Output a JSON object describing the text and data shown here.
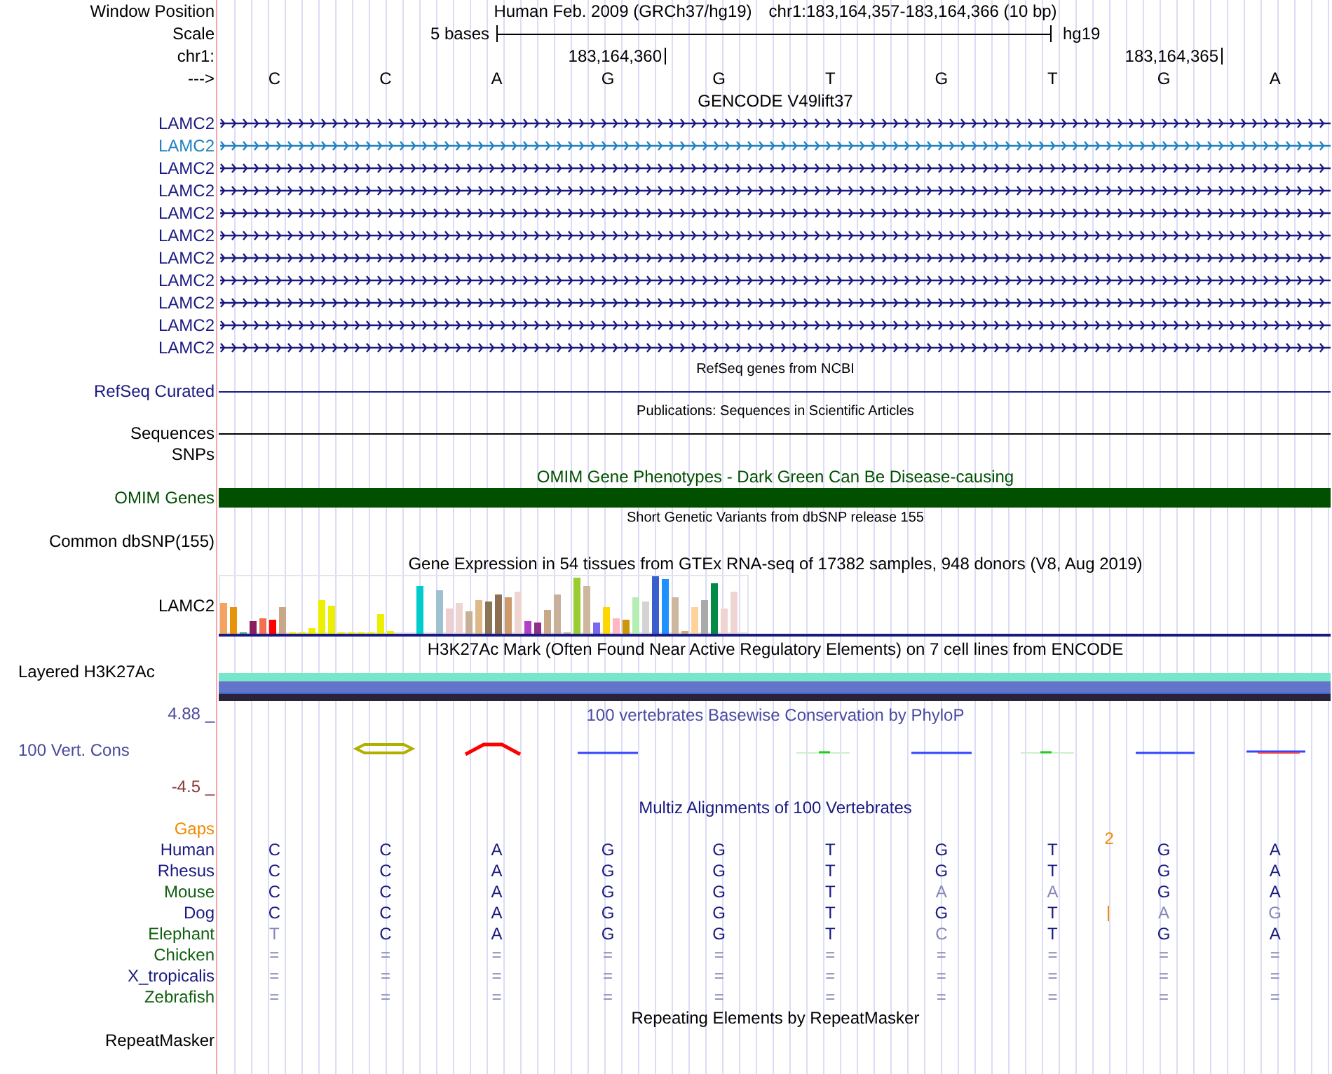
{
  "window_position": {
    "label": "Window Position",
    "assembly": "Human Feb. 2009 (GRCh37/hg19)",
    "range": "chr1:183,164,357-183,164,366 (10 bp)"
  },
  "scale": {
    "label": "Scale",
    "length": "5 bases",
    "assembly": "hg19"
  },
  "coordinates": {
    "label": "chr1:",
    "positions": [
      "183,164,360",
      "183,164,365"
    ]
  },
  "strand": {
    "label": "--->",
    "bases": [
      "C",
      "C",
      "A",
      "G",
      "G",
      "T",
      "G",
      "T",
      "G",
      "A"
    ]
  },
  "tracks": [
    {
      "kind": "genes",
      "title": "GENCODE V49lift37",
      "rows": [
        {
          "label": "LAMC2",
          "color": "#191980"
        },
        {
          "label": "LAMC2",
          "color": "#2080c0"
        },
        {
          "label": "LAMC2",
          "color": "#191980"
        },
        {
          "label": "LAMC2",
          "color": "#191980"
        },
        {
          "label": "LAMC2",
          "color": "#191980"
        },
        {
          "label": "LAMC2",
          "color": "#191980"
        },
        {
          "label": "LAMC2",
          "color": "#191980"
        },
        {
          "label": "LAMC2",
          "color": "#191980"
        },
        {
          "label": "LAMC2",
          "color": "#191980"
        },
        {
          "label": "LAMC2",
          "color": "#191980"
        },
        {
          "label": "LAMC2",
          "color": "#191980"
        }
      ]
    },
    {
      "kind": "line",
      "title": "RefSeq genes from NCBI",
      "label": "RefSeq Curated",
      "color": "#191980"
    },
    {
      "kind": "line",
      "title": "Publications: Sequences in Scientific Articles",
      "label": "Sequences",
      "color": "#000000"
    },
    {
      "kind": "label",
      "label": "SNPs"
    },
    {
      "kind": "bar",
      "title": "OMIM Gene Phenotypes - Dark Green Can Be Disease-causing",
      "label": "OMIM Genes",
      "color": "#005000"
    },
    {
      "kind": "variants",
      "title": "Short Genetic Variants from dbSNP release 155",
      "label": "Common dbSNP(155)"
    },
    {
      "kind": "expression",
      "title": "Gene Expression in 54 tissues from GTEx RNA-seq of 17382 samples, 948 donors (V8, Aug 2019)",
      "label": "LAMC2"
    },
    {
      "kind": "layered",
      "title": "H3K27Ac Mark (Often Found Near Active Regulatory Elements) on 7 cell lines from ENCODE",
      "label": "Layered H3K27Ac"
    },
    {
      "kind": "conservation",
      "title": "100 vertebrates Basewise Conservation by PhyloP",
      "label": "100 Vert. Cons",
      "max": "4.88 _",
      "min": "-4.5 _"
    },
    {
      "kind": "alignment",
      "title": "Multiz Alignments of 100 Vertebrates",
      "gaps": {
        "label": "Gaps",
        "count": "2"
      },
      "species": [
        {
          "label": "Human",
          "color": "#191980",
          "insertion": false,
          "bases": [
            {
              "t": "C",
              "faded": false
            },
            {
              "t": "C",
              "faded": false
            },
            {
              "t": "A",
              "faded": false
            },
            {
              "t": "G",
              "faded": false
            },
            {
              "t": "G",
              "faded": false
            },
            {
              "t": "T",
              "faded": false
            },
            {
              "t": "G",
              "faded": false
            },
            {
              "t": "T",
              "faded": false
            },
            {
              "t": "G",
              "faded": false
            },
            {
              "t": "A",
              "faded": false
            }
          ]
        },
        {
          "label": "Rhesus",
          "color": "#191980",
          "insertion": false,
          "bases": [
            {
              "t": "C",
              "faded": false
            },
            {
              "t": "C",
              "faded": false
            },
            {
              "t": "A",
              "faded": false
            },
            {
              "t": "G",
              "faded": false
            },
            {
              "t": "G",
              "faded": false
            },
            {
              "t": "T",
              "faded": false
            },
            {
              "t": "G",
              "faded": false
            },
            {
              "t": "T",
              "faded": false
            },
            {
              "t": "G",
              "faded": false
            },
            {
              "t": "A",
              "faded": false
            }
          ]
        },
        {
          "label": "Mouse",
          "color": "#106010",
          "insertion": false,
          "bases": [
            {
              "t": "C",
              "faded": false
            },
            {
              "t": "C",
              "faded": false
            },
            {
              "t": "A",
              "faded": false
            },
            {
              "t": "G",
              "faded": false
            },
            {
              "t": "G",
              "faded": false
            },
            {
              "t": "T",
              "faded": false
            },
            {
              "t": "A",
              "faded": true
            },
            {
              "t": "A",
              "faded": true
            },
            {
              "t": "G",
              "faded": false
            },
            {
              "t": "A",
              "faded": false
            }
          ]
        },
        {
          "label": "Dog",
          "color": "#191980",
          "insertion": true,
          "bases": [
            {
              "t": "C",
              "faded": false
            },
            {
              "t": "C",
              "faded": false
            },
            {
              "t": "A",
              "faded": false
            },
            {
              "t": "G",
              "faded": false
            },
            {
              "t": "G",
              "faded": false
            },
            {
              "t": "T",
              "faded": false
            },
            {
              "t": "G",
              "faded": false
            },
            {
              "t": "T",
              "faded": false
            },
            {
              "t": "A",
              "faded": true
            },
            {
              "t": "G",
              "faded": true
            }
          ]
        },
        {
          "label": "Elephant",
          "color": "#106010",
          "insertion": false,
          "bases": [
            {
              "t": "T",
              "faded": true
            },
            {
              "t": "C",
              "faded": false
            },
            {
              "t": "A",
              "faded": false
            },
            {
              "t": "G",
              "faded": false
            },
            {
              "t": "G",
              "faded": false
            },
            {
              "t": "T",
              "faded": false
            },
            {
              "t": "C",
              "faded": true
            },
            {
              "t": "T",
              "faded": false
            },
            {
              "t": "G",
              "faded": false
            },
            {
              "t": "A",
              "faded": false
            }
          ]
        },
        {
          "label": "Chicken",
          "color": "#106010",
          "insertion": false,
          "bases": [
            {
              "t": "=",
              "faded": true
            },
            {
              "t": "=",
              "faded": true
            },
            {
              "t": "=",
              "faded": true
            },
            {
              "t": "=",
              "faded": true
            },
            {
              "t": "=",
              "faded": true
            },
            {
              "t": "=",
              "faded": true
            },
            {
              "t": "=",
              "faded": true
            },
            {
              "t": "=",
              "faded": true
            },
            {
              "t": "=",
              "faded": true
            },
            {
              "t": "=",
              "faded": true
            }
          ]
        },
        {
          "label": "X_tropicalis",
          "color": "#191980",
          "insertion": false,
          "bases": [
            {
              "t": "=",
              "faded": true
            },
            {
              "t": "=",
              "faded": true
            },
            {
              "t": "=",
              "faded": true
            },
            {
              "t": "=",
              "faded": true
            },
            {
              "t": "=",
              "faded": true
            },
            {
              "t": "=",
              "faded": true
            },
            {
              "t": "=",
              "faded": true
            },
            {
              "t": "=",
              "faded": true
            },
            {
              "t": "=",
              "faded": true
            },
            {
              "t": "=",
              "faded": true
            }
          ]
        },
        {
          "label": "Zebrafish",
          "color": "#106010",
          "insertion": false,
          "bases": [
            {
              "t": "=",
              "faded": true
            },
            {
              "t": "=",
              "faded": true
            },
            {
              "t": "=",
              "faded": true
            },
            {
              "t": "=",
              "faded": true
            },
            {
              "t": "=",
              "faded": true
            },
            {
              "t": "=",
              "faded": true
            },
            {
              "t": "=",
              "faded": true
            },
            {
              "t": "=",
              "faded": true
            },
            {
              "t": "=",
              "faded": true
            },
            {
              "t": "=",
              "faded": true
            }
          ]
        }
      ]
    },
    {
      "kind": "variants",
      "title": "Repeating Elements by RepeatMasker",
      "label": "RepeatMasker"
    }
  ]
}
